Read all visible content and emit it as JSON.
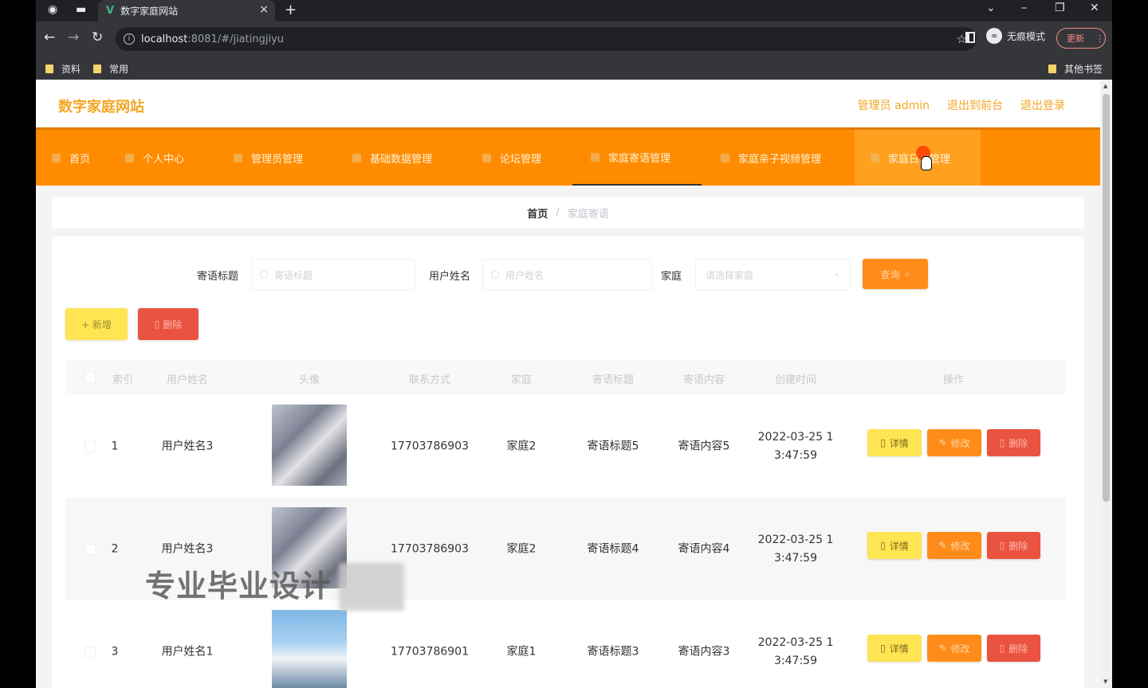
{
  "browser": {
    "tab_title": "数字家庭网站",
    "tab_logo": "V",
    "url_host": "localhost",
    "url_path": ":8081/#/jiatingjiyu",
    "incognito_label": "无痕模式",
    "update_label": "更新",
    "bookmarks": [
      "资料",
      "常用"
    ],
    "other_bookmarks": "其他书签"
  },
  "header": {
    "site_title": "数字家庭网站",
    "links": [
      "管理员 admin",
      "退出到前台",
      "退出登录"
    ]
  },
  "nav": {
    "items": [
      "首页",
      "个人中心",
      "管理员管理",
      "基础数据管理",
      "论坛管理",
      "家庭寄语管理",
      "家庭亲子视频管理",
      "家庭日志管理"
    ]
  },
  "breadcrumb": {
    "home": "首页",
    "separator": "/",
    "current": "家庭寄语"
  },
  "search": {
    "label1": "寄语标题",
    "placeholder1": "寄语标题",
    "label2": "用户姓名",
    "placeholder2": "用户姓名",
    "label3": "家庭",
    "placeholder3": "请选择家庭",
    "query_label": "查询"
  },
  "actions": {
    "add_label": "+ 新增",
    "delete_label": "删除"
  },
  "table": {
    "headers": [
      "索引",
      "用户姓名",
      "头像",
      "联系方式",
      "家庭",
      "寄语标题",
      "寄语内容",
      "创建时间",
      "操作"
    ],
    "rows": [
      {
        "index": "1",
        "name": "用户姓名3",
        "phone": "17703786903",
        "family": "家庭2",
        "title": "寄语标题5",
        "content": "寄语内容5",
        "time1": "2022-03-25 1",
        "time2": "3:47:59"
      },
      {
        "index": "2",
        "name": "用户姓名3",
        "phone": "17703786903",
        "family": "家庭2",
        "title": "寄语标题4",
        "content": "寄语内容4",
        "time1": "2022-03-25 1",
        "time2": "3:47:59"
      },
      {
        "index": "3",
        "name": "用户姓名1",
        "phone": "17703786901",
        "family": "家庭1",
        "title": "寄语标题3",
        "content": "寄语内容3",
        "time1": "2022-03-25 1",
        "time2": "3:47:59"
      }
    ],
    "op_detail": "详情",
    "op_edit": "修改",
    "op_delete": "删除"
  },
  "watermark": "专业毕业设计",
  "colors": {
    "accent": "#ff8c00",
    "title": "#f5a623",
    "add": "#ffe552",
    "danger": "#e9533f"
  }
}
